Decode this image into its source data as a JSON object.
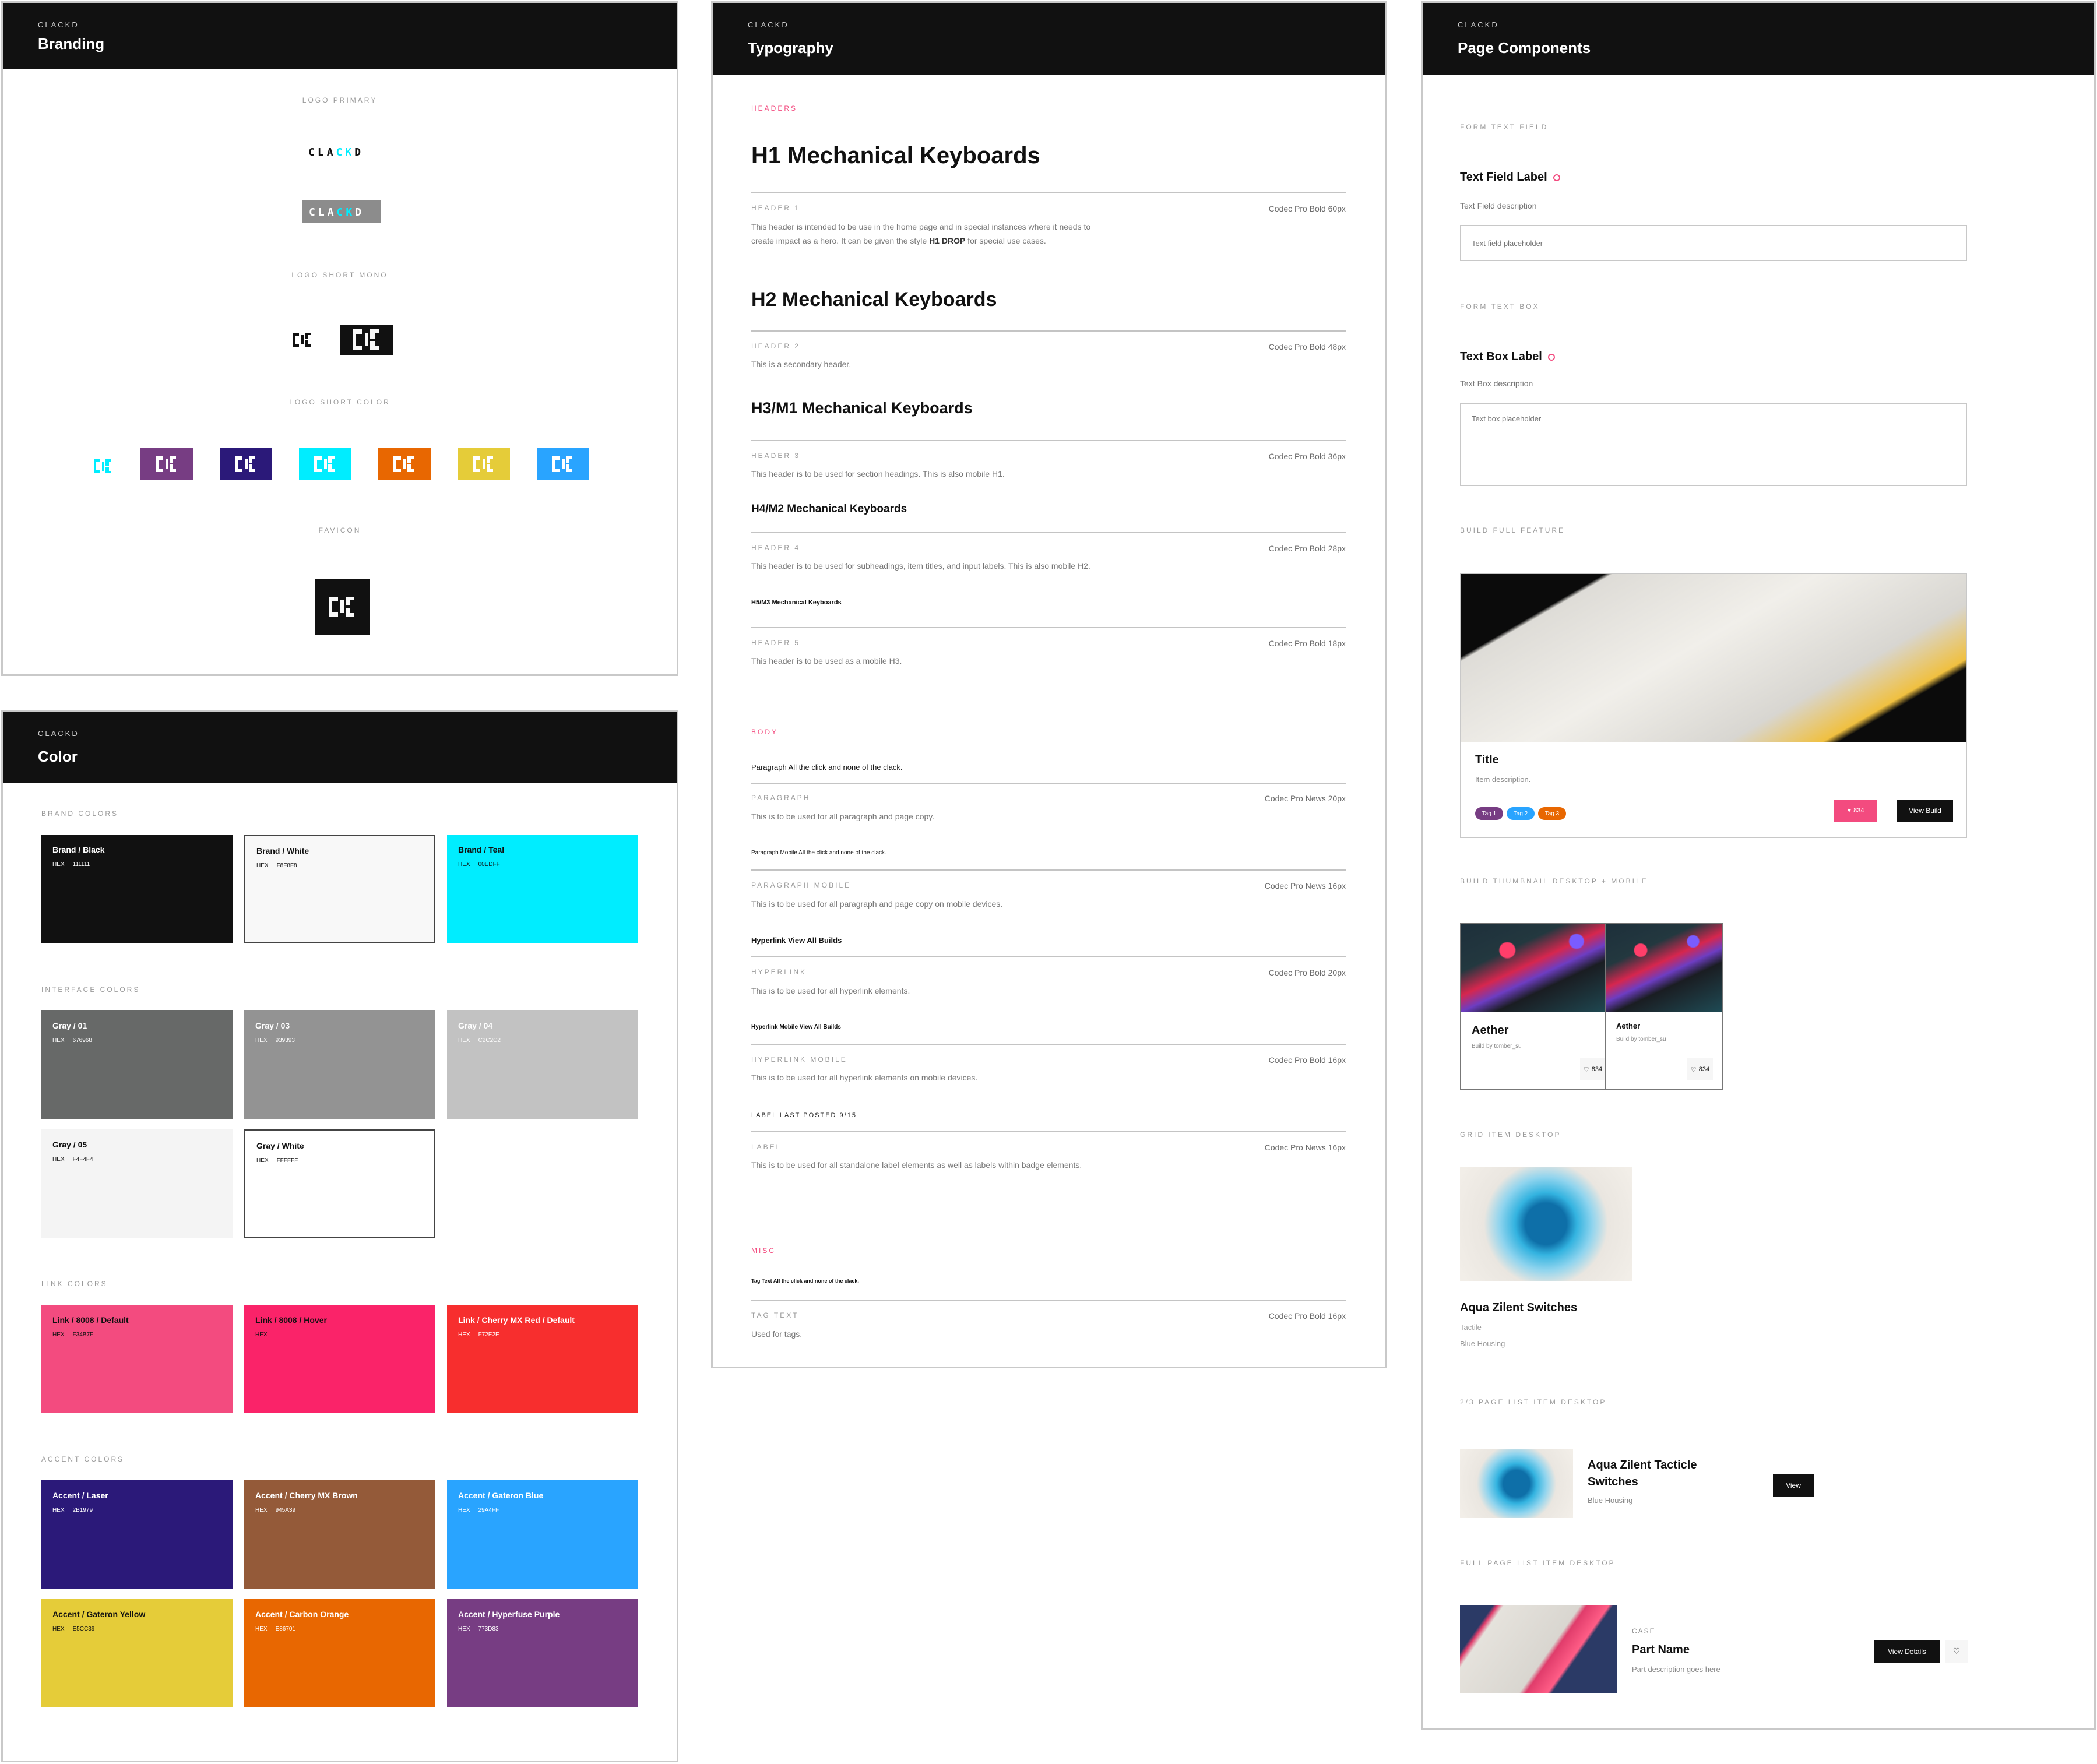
{
  "brand_name": "CLACKD",
  "colors": {
    "brand_black": "#111111",
    "brand_white": "#F8F8F8",
    "brand_teal": "#00EDFF",
    "pink": "#F34B7F"
  },
  "branding": {
    "eyebrow": "CLACKD",
    "title": "Branding",
    "sections": {
      "logo_primary": "LOGO PRIMARY",
      "logo_short_mono": "LOGO SHORT MONO",
      "logo_short_color": "LOGO SHORT COLOR",
      "favicon": "FAVICON"
    },
    "wordmark_letters": [
      "C",
      "L",
      "A",
      "C",
      "K",
      "D"
    ],
    "short_color_backgrounds": [
      "#773D83",
      "#2B1979",
      "#00EDFF",
      "#E86701",
      "#E5CC39",
      "#29A4FF"
    ]
  },
  "color": {
    "eyebrow": "CLACKD",
    "title": "Color",
    "hex_label": "HEX",
    "groups": [
      {
        "label": "BRAND COLORS",
        "swatches": [
          {
            "name": "Brand / Black",
            "hex": "111111",
            "bg": "#111111",
            "fg": "#ffffff"
          },
          {
            "name": "Brand / White",
            "hex": "F8F8F8",
            "bg": "#F8F8F8",
            "fg": "#111111"
          },
          {
            "name": "Brand / Teal",
            "hex": "00EDFF",
            "bg": "#00EDFF",
            "fg": "#111111"
          }
        ]
      },
      {
        "label": "INTERFACE COLORS",
        "swatches": [
          {
            "name": "Gray / 01",
            "hex": "676968",
            "bg": "#676968",
            "fg": "#ffffff"
          },
          {
            "name": "Gray / 03",
            "hex": "939393",
            "bg": "#939393",
            "fg": "#ffffff"
          },
          {
            "name": "Gray / 04",
            "hex": "C2C2C2",
            "bg": "#C2C2C2",
            "fg": "#ffffff"
          },
          {
            "name": "Gray / 05",
            "hex": "F4F4F4",
            "bg": "#F4F4F4",
            "fg": "#111111"
          },
          {
            "name": "Gray / White",
            "hex": "FFFFFF",
            "bg": "#FFFFFF",
            "fg": "#111111"
          }
        ]
      },
      {
        "label": "LINK COLORS",
        "swatches": [
          {
            "name": "Link / 8008 / Default",
            "hex": "F34B7F",
            "bg": "#F34B7F",
            "fg": "#111111"
          },
          {
            "name": "Link / 8008 / Hover",
            "hex": "",
            "bg": "#FA2369",
            "fg": "#111111"
          },
          {
            "name": "Link / Cherry MX Red / Default",
            "hex": "F72E2E",
            "bg": "#F72E2E",
            "fg": "#ffffff"
          }
        ]
      },
      {
        "label": "ACCENT COLORS",
        "swatches": [
          {
            "name": "Accent / Laser",
            "hex": "2B1979",
            "bg": "#2B1979",
            "fg": "#ffffff"
          },
          {
            "name": "Accent / Cherry MX Brown",
            "hex": "945A39",
            "bg": "#945A39",
            "fg": "#ffffff"
          },
          {
            "name": "Accent / Gateron Blue",
            "hex": "29A4FF",
            "bg": "#29A4FF",
            "fg": "#ffffff"
          },
          {
            "name": "Accent / Gateron Yellow",
            "hex": "E5CC39",
            "bg": "#E5CC39",
            "fg": "#111111"
          },
          {
            "name": "Accent / Carbon Orange",
            "hex": "E86701",
            "bg": "#E86701",
            "fg": "#ffffff"
          },
          {
            "name": "Accent / Hyperfuse Purple",
            "hex": "773D83",
            "bg": "#773D83",
            "fg": "#ffffff"
          }
        ]
      }
    ]
  },
  "typography": {
    "eyebrow": "CLACKD",
    "title": "Typography",
    "sections": {
      "headers": "HEADERS",
      "body": "BODY",
      "misc": "MISC"
    },
    "styles": [
      {
        "sample": "H1 Mechanical Keyboards",
        "key": "HEADER 1",
        "spec": "Codec Pro Bold 60px",
        "desc_pre": "This header is intended to be use in the home page and in special instances where it needs to create impact as a hero. It can be given the style ",
        "desc_bold": "H1 DROP",
        "desc_post": " for special use cases."
      },
      {
        "sample": "H2 Mechanical Keyboards",
        "key": "HEADER 2",
        "spec": "Codec Pro Bold 48px",
        "desc_pre": "This is a secondary header."
      },
      {
        "sample": "H3/M1 Mechanical Keyboards",
        "key": "HEADER 3",
        "spec": "Codec Pro Bold 36px",
        "desc_pre": "This header is to be used for section headings. This is also mobile H1."
      },
      {
        "sample": "H4/M2 Mechanical Keyboards",
        "key": "HEADER 4",
        "spec": "Codec Pro Bold 28px",
        "desc_pre": "This header is to be used for subheadings, item titles, and input labels. This is also mobile H2."
      },
      {
        "sample": "H5/M3 Mechanical Keyboards",
        "key": "HEADER 5",
        "spec": "Codec Pro Bold 18px",
        "desc_pre": "This header is to be used as a mobile H3."
      },
      {
        "sample": "Paragraph All the click and none of the clack.",
        "key": "PARAGRAPH",
        "spec": "Codec Pro News 20px",
        "desc_pre": "This is to be used for all paragraph and page copy."
      },
      {
        "sample": "Paragraph Mobile All the click and none of the clack.",
        "key": "PARAGRAPH MOBILE",
        "spec": "Codec Pro News 16px",
        "desc_pre": "This is to be used for all paragraph and page copy on mobile devices."
      },
      {
        "sample": "Hyperlink View All Builds",
        "key": "HYPERLINK",
        "spec": "Codec Pro Bold 20px",
        "desc_pre": "This is to be used for all hyperlink elements."
      },
      {
        "sample": "Hyperlink Mobile View All Builds",
        "key": "HYPERLINK MOBILE",
        "spec": "Codec Pro Bold 16px",
        "desc_pre": "This is to be used for all hyperlink elements on mobile devices."
      },
      {
        "sample": "LABEL LAST POSTED 9/15",
        "key": "LABEL",
        "spec": "Codec Pro News 16px",
        "desc_pre": "This is to be used for all standalone label elements as well as labels within badge elements."
      },
      {
        "sample": "Tag Text All the click and none of the clack.",
        "key": "TAG TEXT",
        "spec": "Codec Pro Bold 16px",
        "desc_pre": "Used for tags."
      }
    ]
  },
  "components": {
    "eyebrow": "CLACKD",
    "title": "Page Components",
    "text_field": {
      "section": "FORM TEXT FIELD",
      "label": "Text Field Label",
      "description": "Text Field description",
      "placeholder": "Text field placeholder",
      "value": ""
    },
    "text_box": {
      "section": "FORM TEXT BOX",
      "label": "Text Box Label",
      "description": "Text Box description",
      "placeholder": "Text box placeholder",
      "value": ""
    },
    "build_feature": {
      "section": "BUILD FULL FEATURE",
      "title": "Title",
      "description": "Item description.",
      "tags": [
        {
          "label": "Tag 1",
          "color": "#773D83"
        },
        {
          "label": "Tag 2",
          "color": "#29A4FF"
        },
        {
          "label": "Tag 3",
          "color": "#E86701"
        }
      ],
      "likes": "834",
      "button": "View Build"
    },
    "build_thumbnail": {
      "section": "BUILD THUMBNAIL DESKTOP + MOBILE",
      "cards": [
        {
          "title": "Aether",
          "byline": "Build by tomber_su",
          "likes": "834"
        },
        {
          "title": "Aether",
          "byline": "Build by tomber_su",
          "likes": "834"
        }
      ]
    },
    "grid_item": {
      "section": "GRID ITEM DESKTOP",
      "title": "Aqua Zilent Switches",
      "line1": "Tactile",
      "line2": "Blue Housing"
    },
    "list_item_23": {
      "section": "2/3 PAGE LIST ITEM DESKTOP",
      "title": "Aqua Zilent Tacticle Switches",
      "subtitle": "Blue Housing",
      "button": "View"
    },
    "list_item_full": {
      "section": "FULL PAGE LIST ITEM DESKTOP",
      "category": "CASE",
      "title": "Part Name",
      "description": "Part description goes here",
      "button": "View Details"
    }
  }
}
